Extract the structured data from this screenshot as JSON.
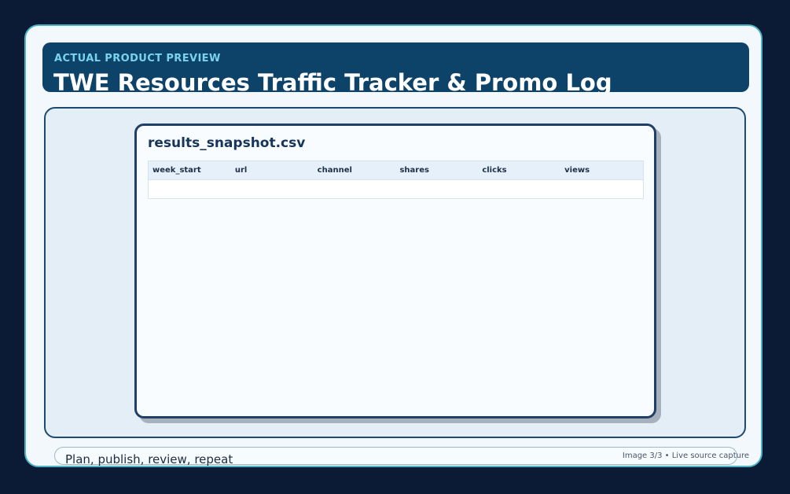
{
  "header": {
    "eyebrow": "ACTUAL PRODUCT PREVIEW",
    "title": "TWE Resources Traffic Tracker & Promo Log"
  },
  "preview": {
    "file_name": "results_snapshot.csv",
    "columns": [
      "week_start",
      "url",
      "channel",
      "shares",
      "clicks",
      "views"
    ],
    "rows": []
  },
  "footer": {
    "tagline": "Plan, publish, review, repeat",
    "caption": "Image 3/3 • Live source capture"
  },
  "colors": {
    "background": "#0b1b36",
    "frame_border": "#4fb3c8",
    "header_bg": "#0e4369",
    "eyebrow": "#79d3ee",
    "card_border": "#1f3f66"
  }
}
